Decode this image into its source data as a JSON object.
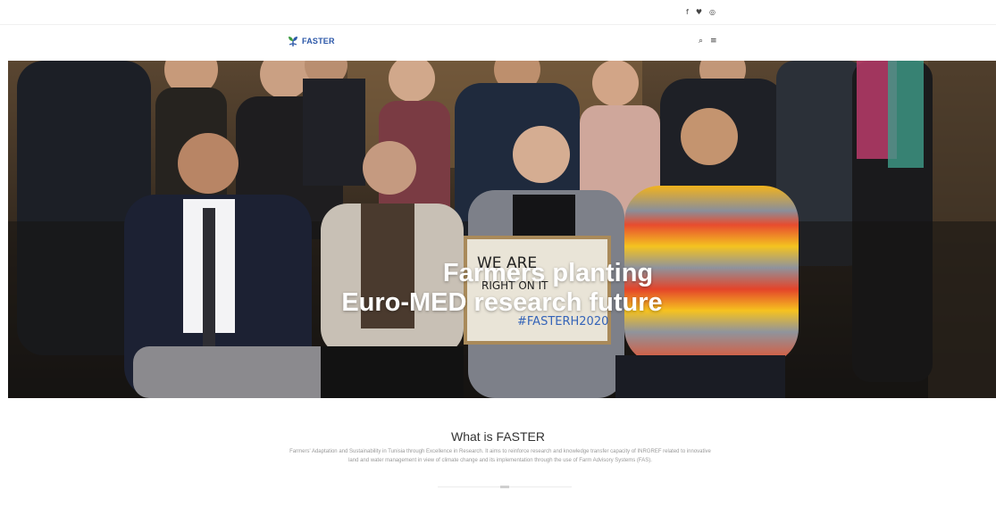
{
  "topbar": {
    "social": [
      {
        "name": "facebook-icon",
        "glyph": "f"
      },
      {
        "name": "twitter-icon",
        "glyph": "♥"
      },
      {
        "name": "instagram-icon",
        "glyph": "◎"
      }
    ]
  },
  "navbar": {
    "logo_text": "FASTER",
    "search_glyph": "⌕",
    "menu_glyph": "≡"
  },
  "hero": {
    "title_line1": "Farmers planting",
    "title_line2": "Euro-MED research future",
    "sign_line1": "WE ARE",
    "sign_line2": "RIGHT ON IT",
    "sign_hashtag": "#FASTERH2020"
  },
  "about": {
    "heading": "What is FASTER",
    "text": "Farmers' Adaptation and Sustainability in Tunisia through Excellence in Research. It aims to reinforce research and knowledge transfer capacity of INRGREF related to innovative land and water management in view of climate change and its implementation through the use of Farm Advisory Systems (FAS)."
  },
  "colors": {
    "brand_blue": "#2b57a8",
    "brand_green": "#3a9a3f",
    "hero_text": "#ffffff",
    "body_text": "#333333",
    "muted_text": "#9a9a9a"
  }
}
